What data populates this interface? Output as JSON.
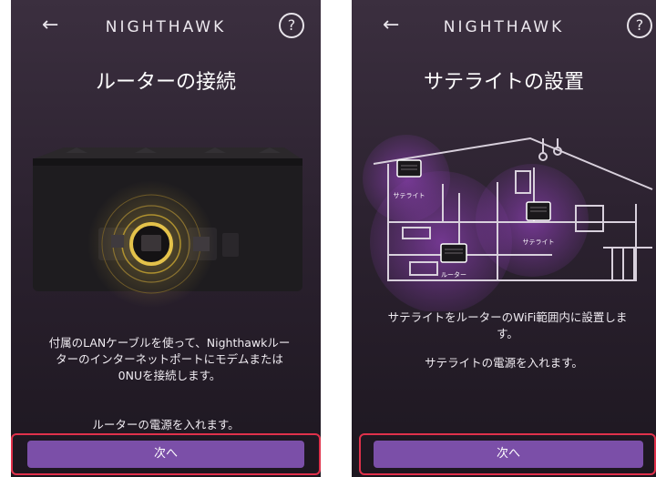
{
  "screens": [
    {
      "brand": "NIGHTHAWK",
      "back_glyph": "←",
      "help_glyph": "?",
      "title": "ルーターの接続",
      "description": "付属のLANケーブルを使って、Nighthawkルーターのインターネットポートにモデムまたは0NUを接続します。",
      "note": "ルーターの電源を入れます。",
      "next_label": "次へ"
    },
    {
      "brand": "NIGHTHAWK",
      "back_glyph": "←",
      "help_glyph": "?",
      "title": "サテライトの設置",
      "illustration_labels": {
        "satellite_upstairs": "サテライト",
        "satellite_right": "サテライト",
        "router": "ルーター"
      },
      "description": "サテライトをルーターのWiFi範囲内に設置します。",
      "note": "サテライトの電源を入れます。",
      "next_label": "次へ"
    }
  ],
  "icons": {
    "back": "arrow-left-icon",
    "help": "question-circle-icon"
  },
  "colors": {
    "button": "#7b4fa8",
    "highlight_border": "#e0314b",
    "port_ring": "#e4c24a",
    "wifi_glow": "#8a3fb0"
  }
}
